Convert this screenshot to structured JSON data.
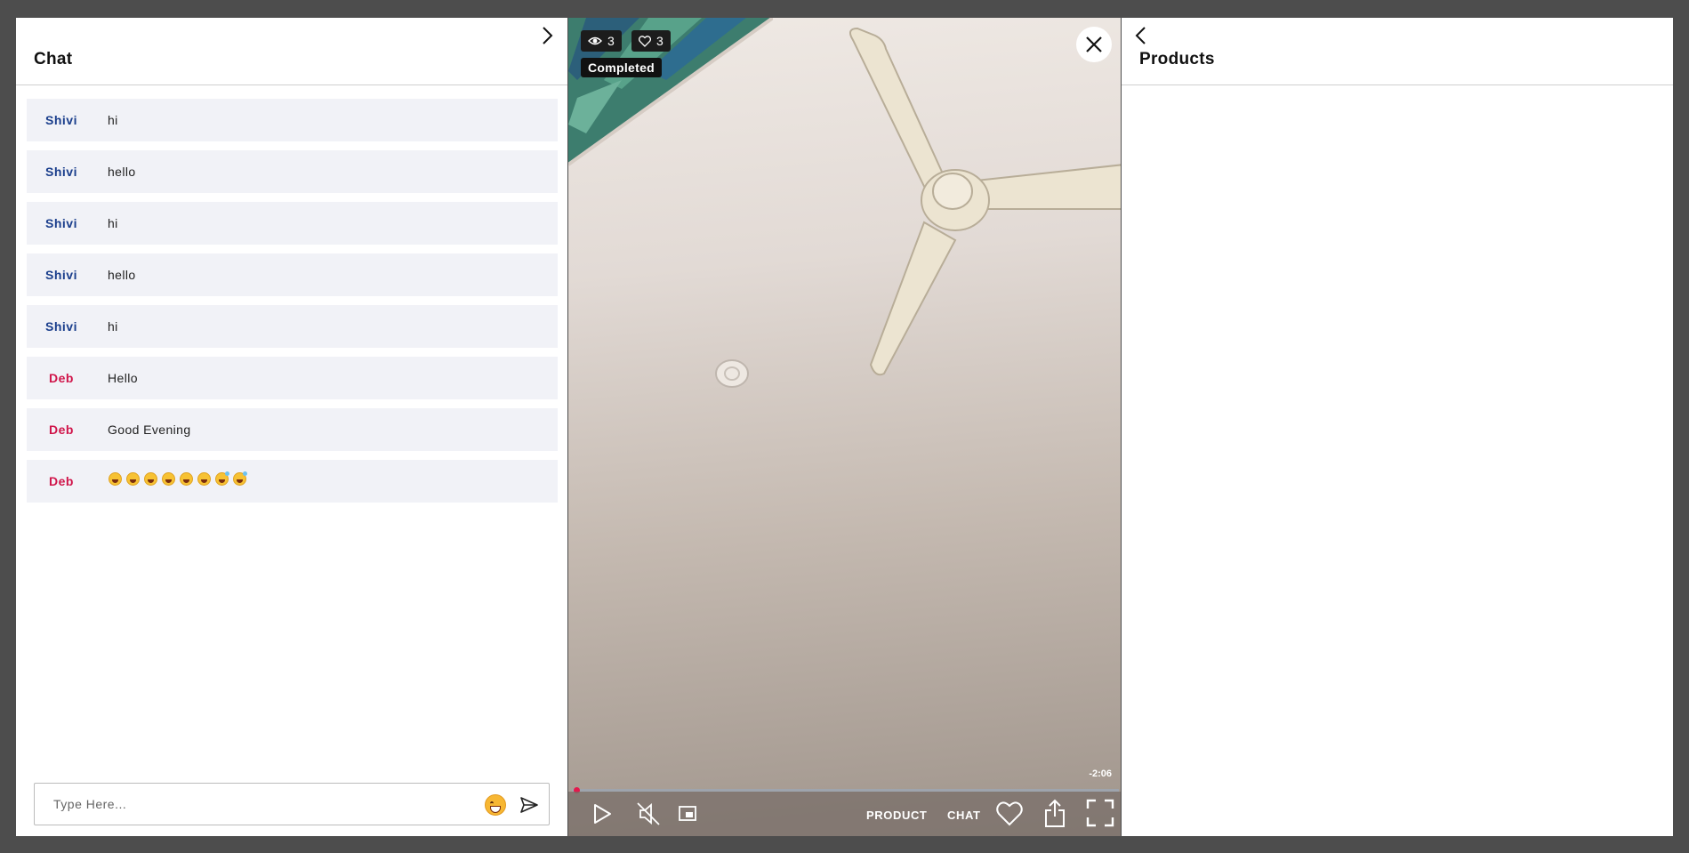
{
  "chat": {
    "title": "Chat",
    "collapse_icon": "chevron-right-icon",
    "messages": [
      {
        "user": "Shivi",
        "text": "hi"
      },
      {
        "user": "Shivi",
        "text": "hello"
      },
      {
        "user": "Shivi",
        "text": "hi"
      },
      {
        "user": "Shivi",
        "text": "hello"
      },
      {
        "user": "Shivi",
        "text": "hi"
      },
      {
        "user": "Deb",
        "text": "Hello"
      },
      {
        "user": "Deb",
        "text": "Good Evening"
      },
      {
        "user": "Deb",
        "text": "",
        "emojis": [
          "grinning",
          "grinning",
          "smiley",
          "smiley",
          "grin",
          "grin",
          "sweat-smile",
          "sweat-smile"
        ]
      }
    ],
    "user_colors": {
      "Shivi": "#1a3e8c",
      "Deb": "#d0154a"
    },
    "input": {
      "placeholder": "Type Here...",
      "value": ""
    },
    "emoji_button_icon": "emoji-icon",
    "send_icon": "send-icon"
  },
  "video": {
    "views": "3",
    "likes": "3",
    "status": "Completed",
    "time_remaining": "-2:06",
    "progress_fraction": 0.0,
    "product_label": "PRODUCT",
    "chat_label": "CHAT",
    "accent": "#e4194c"
  },
  "products": {
    "title": "Products",
    "back_icon": "chevron-left-icon"
  }
}
